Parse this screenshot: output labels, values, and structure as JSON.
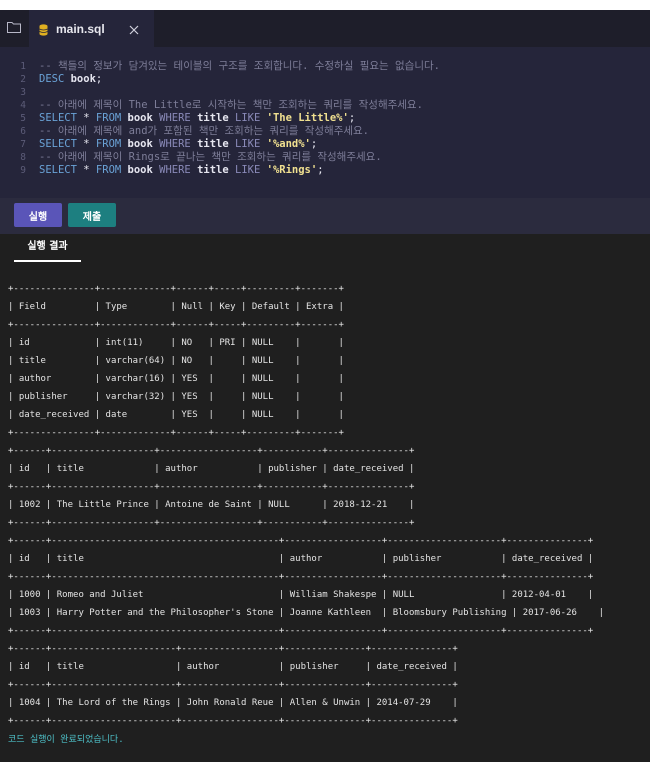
{
  "tab": {
    "title": "main.sql"
  },
  "icons": {
    "explorer": "folder-icon",
    "file": "database-icon",
    "close": "close-icon"
  },
  "editor": {
    "lines": [
      {
        "n": "1",
        "parts": [
          {
            "c": "cm",
            "t": "-- 책들의 정보가 담겨있는 테이블의 구조를 조회합니다. 수정하실 필요는 없습니다."
          }
        ]
      },
      {
        "n": "2",
        "parts": [
          {
            "c": "kw",
            "t": "DESC "
          },
          {
            "c": "id",
            "t": "book"
          },
          {
            "c": "op",
            "t": ";"
          }
        ]
      },
      {
        "n": "3",
        "parts": []
      },
      {
        "n": "4",
        "parts": [
          {
            "c": "cm",
            "t": "-- 아래에 제목이 The Little로 시작하는 책만 조회하는 쿼리를 작성해주세요."
          }
        ]
      },
      {
        "n": "5",
        "parts": [
          {
            "c": "kw",
            "t": "SELECT "
          },
          {
            "c": "op",
            "t": "* "
          },
          {
            "c": "kw",
            "t": "FROM "
          },
          {
            "c": "id",
            "t": "book "
          },
          {
            "c": "kw2",
            "t": "WHERE "
          },
          {
            "c": "id",
            "t": "title "
          },
          {
            "c": "kw2",
            "t": "LIKE "
          },
          {
            "c": "str",
            "t": "'The Little%'"
          },
          {
            "c": "op",
            "t": ";"
          }
        ]
      },
      {
        "n": "6",
        "parts": [
          {
            "c": "cm",
            "t": "-- 아래에 제목에 and가 포함된 책만 조회하는 쿼리를 작성해주세요."
          }
        ]
      },
      {
        "n": "7",
        "parts": [
          {
            "c": "kw",
            "t": "SELECT "
          },
          {
            "c": "op",
            "t": "* "
          },
          {
            "c": "kw",
            "t": "FROM "
          },
          {
            "c": "id",
            "t": "book "
          },
          {
            "c": "kw2",
            "t": "WHERE "
          },
          {
            "c": "id",
            "t": "title "
          },
          {
            "c": "kw2",
            "t": "LIKE "
          },
          {
            "c": "str",
            "t": "'%and%'"
          },
          {
            "c": "op",
            "t": ";"
          }
        ]
      },
      {
        "n": "8",
        "parts": [
          {
            "c": "cm",
            "t": "-- 아래에 제목이 Rings로 끝나는 책만 조회하는 쿼리를 작성해주세요."
          }
        ]
      },
      {
        "n": "9",
        "parts": [
          {
            "c": "kw",
            "t": "SELECT "
          },
          {
            "c": "op",
            "t": "* "
          },
          {
            "c": "kw",
            "t": "FROM "
          },
          {
            "c": "id",
            "t": "book "
          },
          {
            "c": "kw2",
            "t": "WHERE "
          },
          {
            "c": "id",
            "t": "title "
          },
          {
            "c": "kw2",
            "t": "LIKE "
          },
          {
            "c": "str",
            "t": "'%Rings'"
          },
          {
            "c": "op",
            "t": ";"
          }
        ]
      }
    ]
  },
  "toolbar": {
    "run_label": "실행",
    "submit_label": "제출"
  },
  "results": {
    "tab_label": "실행 결과",
    "output_lines": [
      "+---------------+-------------+------+-----+---------+-------+",
      "| Field         | Type        | Null | Key | Default | Extra |",
      "+---------------+-------------+------+-----+---------+-------+",
      "| id            | int(11)     | NO   | PRI | NULL    |       |",
      "| title         | varchar(64) | NO   |     | NULL    |       |",
      "| author        | varchar(16) | YES  |     | NULL    |       |",
      "| publisher     | varchar(32) | YES  |     | NULL    |       |",
      "| date_received | date        | YES  |     | NULL    |       |",
      "+---------------+-------------+------+-----+---------+-------+",
      "+------+-------------------+------------------+-----------+---------------+",
      "| id   | title             | author           | publisher | date_received |",
      "+------+-------------------+------------------+-----------+---------------+",
      "| 1002 | The Little Prince | Antoine de Saint | NULL      | 2018-12-21    |",
      "+------+-------------------+------------------+-----------+---------------+",
      "+------+------------------------------------------+------------------+---------------------+---------------+",
      "| id   | title                                    | author           | publisher           | date_received |",
      "+------+------------------------------------------+------------------+---------------------+---------------+",
      "| 1000 | Romeo and Juliet                         | William Shakespe | NULL                | 2012-04-01    |",
      "| 1003 | Harry Potter and the Philosopher's Stone | Joanne Kathleen  | Bloomsbury Publishing | 2017-06-26    |",
      "+------+------------------------------------------+------------------+---------------------+---------------+",
      "+------+-----------------------+------------------+---------------+---------------+",
      "| id   | title                 | author           | publisher     | date_received |",
      "+------+-----------------------+------------------+---------------+---------------+",
      "| 1004 | The Lord of the Rings | John Ronald Reue | Allen & Unwin | 2014-07-29    |",
      "+------+-----------------------+------------------+---------------+---------------+"
    ],
    "status": "코드 실행이 완료되었습니다."
  }
}
